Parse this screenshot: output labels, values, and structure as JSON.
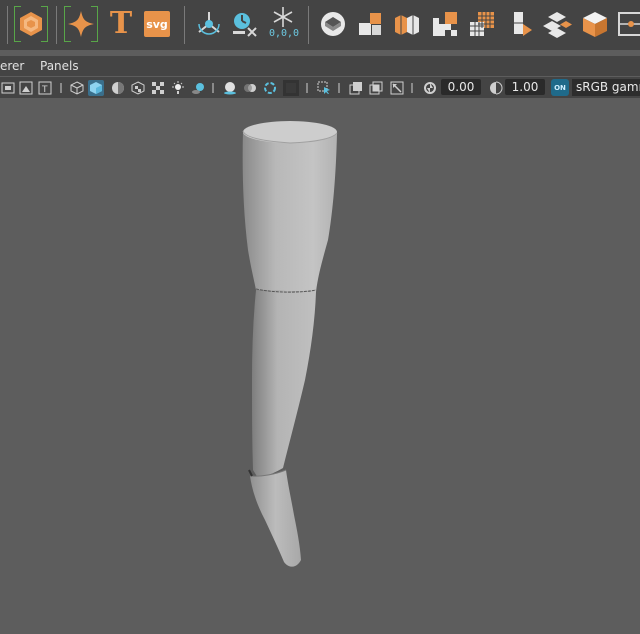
{
  "shelf": {
    "tools": [
      {
        "icon": "polygon-sphere-icon"
      },
      {
        "icon": "sparkle-star-icon"
      },
      {
        "icon": "text-type-icon",
        "glyph": "T"
      },
      {
        "icon": "svg-import-icon",
        "label": "svg"
      },
      {
        "icon": "pivot-locator-icon"
      },
      {
        "icon": "clock-delete-history-icon"
      },
      {
        "icon": "freeze-transform-icon",
        "label": "0,0,0"
      },
      {
        "icon": "uv-editor-icon"
      },
      {
        "icon": "planar-mapping-icon"
      },
      {
        "icon": "cylindrical-mapping-icon"
      },
      {
        "icon": "uv-layout-icon"
      },
      {
        "icon": "uv-grid-icon"
      },
      {
        "icon": "uv-cut-icon"
      },
      {
        "icon": "automatic-mapping-icon"
      },
      {
        "icon": "uv-flatten-icon"
      },
      {
        "icon": "cube-texture-icon"
      },
      {
        "icon": "uv-shell-icon"
      }
    ]
  },
  "menubar": {
    "items": [
      "erer",
      "Panels"
    ]
  },
  "panel_toolbar": {
    "exposure_value": "0.00",
    "gamma_value": "1.00",
    "color_management_badge": "ON",
    "color_space": "sRGB gamma",
    "accent_blue": "#1f6a8a",
    "icons": [
      "bookmark-camera-icon",
      "image-plane-icon",
      "text-icon",
      "wireframe-cube-icon",
      "shaded-cube-icon",
      "shaded-wireframe-icon",
      "textured-icon",
      "checker-icon",
      "lights-icon",
      "shadows-icon",
      "screen-space-ao-icon",
      "motion-blur-icon",
      "anti-alias-icon",
      "isolate-select-icon",
      "xray-icon",
      "xray-joints-icon",
      "backface-icon",
      "select-camera-icon",
      "frame-icon",
      "exposure-icon",
      "gamma-icon"
    ]
  },
  "viewport": {
    "object": "leg-mesh",
    "background_color": "#5d5d5d"
  },
  "colors": {
    "shelf_orange": "#e8934a",
    "selection_green": "#58a648",
    "panel_bg": "#444444"
  }
}
